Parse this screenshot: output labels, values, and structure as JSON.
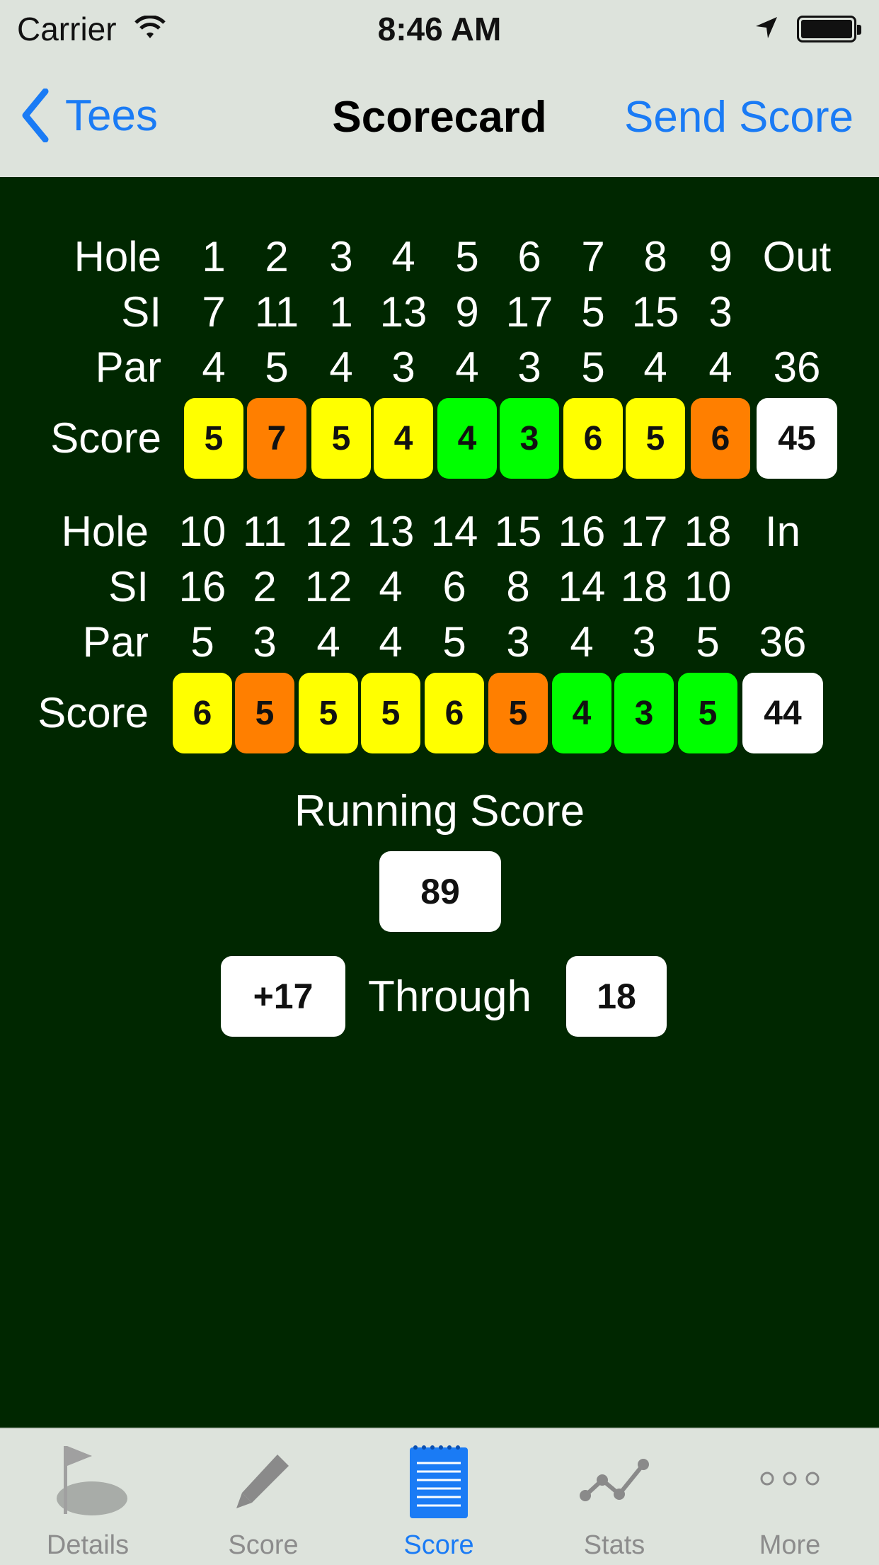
{
  "status_bar": {
    "carrier": "Carrier",
    "time": "8:46 AM"
  },
  "nav": {
    "back_label": "Tees",
    "title": "Scorecard",
    "right_label": "Send Score"
  },
  "front_nine": {
    "labels": {
      "hole": "Hole",
      "si": "SI",
      "par": "Par",
      "score": "Score"
    },
    "holes": [
      "1",
      "2",
      "3",
      "4",
      "5",
      "6",
      "7",
      "8",
      "9"
    ],
    "total_header": "Out",
    "si": [
      "7",
      "11",
      "1",
      "13",
      "9",
      "17",
      "5",
      "15",
      "3"
    ],
    "par": [
      "4",
      "5",
      "4",
      "3",
      "4",
      "3",
      "5",
      "4",
      "4"
    ],
    "par_total": "36",
    "scores": [
      "5",
      "7",
      "5",
      "4",
      "4",
      "3",
      "6",
      "5",
      "6"
    ],
    "score_total": "45"
  },
  "back_nine": {
    "labels": {
      "hole": "Hole",
      "si": "SI",
      "par": "Par",
      "score": "Score"
    },
    "holes": [
      "10",
      "11",
      "12",
      "13",
      "14",
      "15",
      "16",
      "17",
      "18"
    ],
    "total_header": "In",
    "si": [
      "16",
      "2",
      "12",
      "4",
      "6",
      "8",
      "14",
      "18",
      "10"
    ],
    "par": [
      "5",
      "3",
      "4",
      "4",
      "5",
      "3",
      "4",
      "3",
      "5"
    ],
    "par_total": "36",
    "scores": [
      "6",
      "5",
      "5",
      "5",
      "6",
      "5",
      "4",
      "3",
      "5"
    ],
    "score_total": "44"
  },
  "colors": {
    "yellow": "#ffff00",
    "orange": "#ff7f00",
    "green": "#00ff00",
    "white": "#ffffff",
    "background": "#002700",
    "accent": "#1a7bf5"
  },
  "front_colors": [
    "yellow",
    "orange",
    "yellow",
    "yellow",
    "green",
    "green",
    "yellow",
    "yellow",
    "orange"
  ],
  "back_colors": [
    "yellow",
    "orange",
    "yellow",
    "yellow",
    "yellow",
    "orange",
    "green",
    "green",
    "green"
  ],
  "running": {
    "label": "Running Score",
    "total": "89",
    "to_par": "+17",
    "through_label": "Through",
    "through": "18"
  },
  "tabs": [
    {
      "label": "Details",
      "icon": "golf-flag-icon",
      "active": false
    },
    {
      "label": "Score",
      "icon": "pencil-icon",
      "active": false
    },
    {
      "label": "Score",
      "icon": "notepad-icon",
      "active": true
    },
    {
      "label": "Stats",
      "icon": "line-graph-icon",
      "active": false
    },
    {
      "label": "More",
      "icon": "more-dots-icon",
      "active": false
    }
  ]
}
